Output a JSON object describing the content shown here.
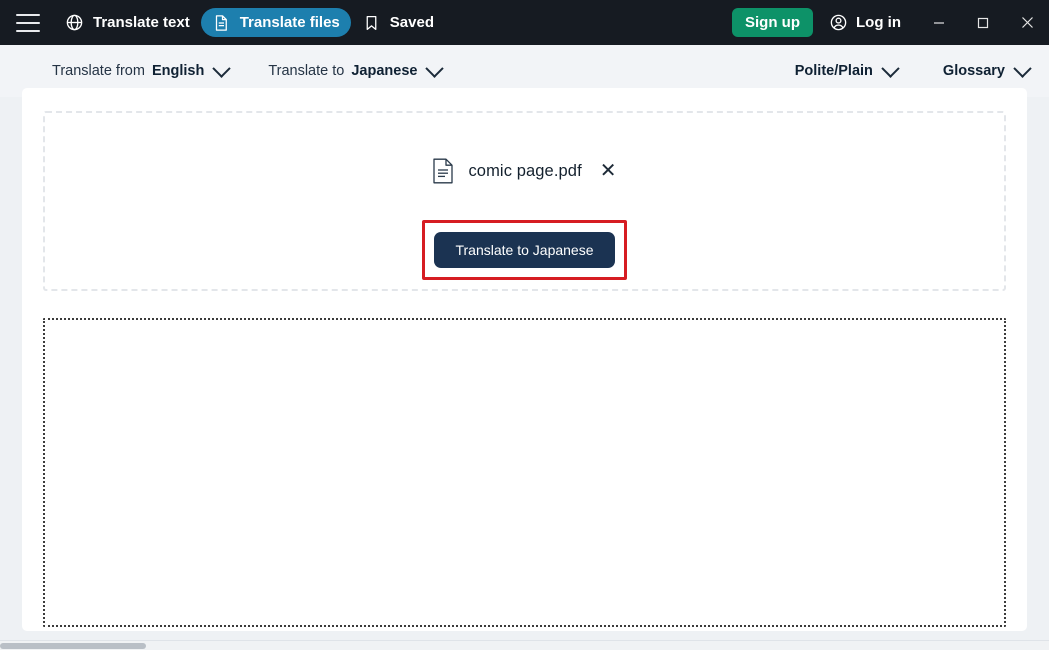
{
  "window": {
    "minimize_label": "Minimize",
    "maximize_label": "Maximize",
    "close_label": "Close"
  },
  "header": {
    "menu_icon": "hamburger-menu-icon",
    "nav": [
      {
        "label": "Translate text",
        "icon": "globe-icon",
        "active": false
      },
      {
        "label": "Translate files",
        "icon": "document-icon",
        "active": true
      },
      {
        "label": "Saved",
        "icon": "bookmark-icon",
        "active": false
      }
    ],
    "signup_label": "Sign up",
    "login_label": "Log in",
    "login_icon": "user-circle-icon",
    "active_tab_color": "#1d7fae",
    "signup_color": "#0d9268",
    "background_color": "#161b22"
  },
  "options_bar": {
    "source": {
      "lead": "Translate from",
      "value": "English",
      "chevron": "chevron-down-icon"
    },
    "target": {
      "lead": "Translate to",
      "value": "Japanese",
      "chevron": "chevron-down-icon"
    },
    "formality": {
      "value": "Polite/Plain",
      "chevron": "chevron-down-icon"
    },
    "glossary": {
      "value": "Glossary",
      "chevron": "chevron-down-icon"
    }
  },
  "main": {
    "dropzone": {
      "file": {
        "icon": "file-document-icon",
        "name": "comic page.pdf",
        "remove_icon": "close-icon"
      },
      "translate_button": {
        "label": "Translate to Japanese",
        "color": "#1b3352",
        "highlight_color": "#d61c22"
      }
    },
    "output_area": {
      "content": ""
    }
  }
}
